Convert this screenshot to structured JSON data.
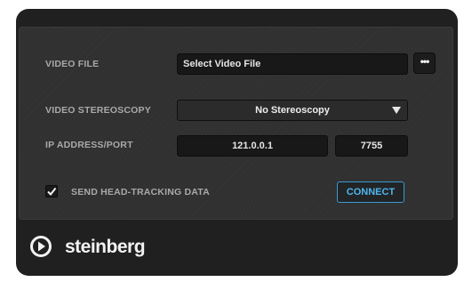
{
  "video_file": {
    "label": "VIDEO FILE",
    "value": "Select Video File",
    "browse_label": "•••"
  },
  "video_stereoscopy": {
    "label": "VIDEO STEREOSCOPY",
    "selected": "No Stereoscopy"
  },
  "ip_address_port": {
    "label": "IP ADDRESS/PORT",
    "ip": "121.0.0.1",
    "port": "7755"
  },
  "head_tracking": {
    "label": "SEND HEAD-TRACKING DATA",
    "checked": true
  },
  "connect": {
    "label": "CONNECT"
  },
  "branding": {
    "name": "steinberg"
  },
  "colors": {
    "accent": "#4fb6ee",
    "panel": "#2f2f2f",
    "frame": "#202020"
  }
}
